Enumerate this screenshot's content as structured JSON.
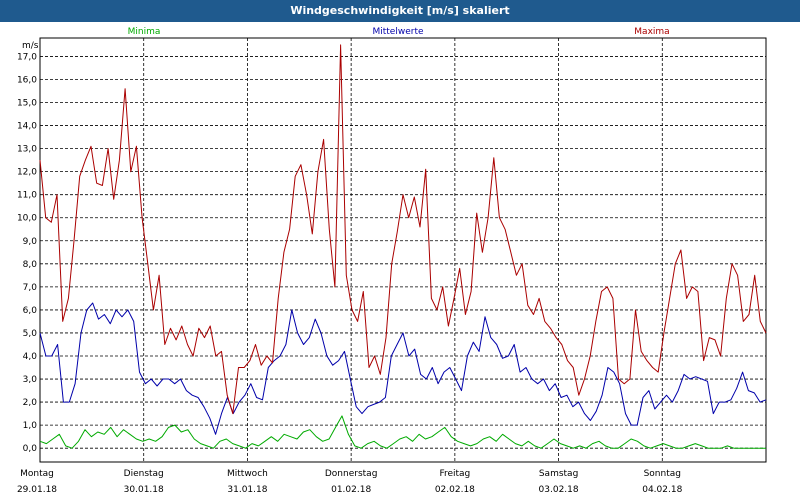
{
  "window": {
    "title": "Windgeschwindigkeit [m/s] skaliert"
  },
  "chart_data": {
    "type": "line",
    "title": "Windgeschwindigkeit [m/s] skaliert",
    "ylabel": "m/s",
    "ylim": [
      0,
      18
    ],
    "yticks": [
      "0,0",
      "1,0",
      "2,0",
      "3,0",
      "4,0",
      "5,0",
      "6,0",
      "7,0",
      "8,0",
      "9,0",
      "10,0",
      "11,0",
      "12,0",
      "13,0",
      "14,0",
      "15,0",
      "16,0",
      "17,0"
    ],
    "grid": true,
    "legend_position": "top",
    "x_days": [
      {
        "name": "Montag",
        "date": "29.01.18"
      },
      {
        "name": "Dienstag",
        "date": "30.01.18"
      },
      {
        "name": "Mittwoch",
        "date": "31.01.18"
      },
      {
        "name": "Donnerstag",
        "date": "01.02.18"
      },
      {
        "name": "Freitag",
        "date": "02.02.18"
      },
      {
        "name": "Samstag",
        "date": "03.02.18"
      },
      {
        "name": "Sonntag",
        "date": "04.02.18"
      }
    ],
    "series": [
      {
        "name": "Minima",
        "color": "#00aa00",
        "values": [
          0.3,
          0.2,
          0.4,
          0.6,
          0.1,
          0.0,
          0.3,
          0.8,
          0.5,
          0.7,
          0.6,
          0.9,
          0.5,
          0.8,
          0.6,
          0.4,
          0.3,
          0.4,
          0.3,
          0.5,
          0.9,
          1.0,
          0.7,
          0.8,
          0.4,
          0.2,
          0.1,
          0.0,
          0.3,
          0.4,
          0.2,
          0.1,
          0.0,
          0.2,
          0.1,
          0.3,
          0.5,
          0.3,
          0.6,
          0.5,
          0.4,
          0.7,
          0.8,
          0.5,
          0.3,
          0.4,
          0.9,
          1.4,
          0.6,
          0.1,
          0.0,
          0.2,
          0.3,
          0.1,
          0.0,
          0.2,
          0.4,
          0.5,
          0.3,
          0.6,
          0.4,
          0.5,
          0.7,
          0.9,
          0.5,
          0.3,
          0.2,
          0.1,
          0.2,
          0.4,
          0.5,
          0.3,
          0.6,
          0.4,
          0.2,
          0.1,
          0.3,
          0.1,
          0.0,
          0.2,
          0.4,
          0.2,
          0.1,
          0.0,
          0.1,
          0.0,
          0.2,
          0.3,
          0.1,
          0.0,
          0.0,
          0.2,
          0.4,
          0.3,
          0.1,
          0.0,
          0.1,
          0.2,
          0.1,
          0.0,
          0.0,
          0.1,
          0.2,
          0.1,
          0.0,
          0.0,
          0.0,
          0.1,
          0.0,
          0.0,
          0.0,
          0.0,
          0.0,
          0.0
        ]
      },
      {
        "name": "Mittelwerte",
        "color": "#0000aa",
        "values": [
          5.0,
          4.0,
          4.0,
          4.5,
          2.0,
          2.0,
          2.8,
          5.0,
          6.0,
          6.3,
          5.6,
          5.8,
          5.4,
          6.0,
          5.7,
          6.0,
          5.5,
          3.3,
          2.8,
          3.0,
          2.7,
          3.0,
          3.0,
          2.8,
          3.0,
          2.5,
          2.3,
          2.2,
          1.8,
          1.3,
          0.6,
          1.5,
          2.2,
          1.5,
          2.0,
          2.3,
          2.8,
          2.2,
          2.1,
          3.5,
          3.8,
          4.0,
          4.5,
          6.0,
          5.0,
          4.5,
          4.8,
          5.6,
          5.0,
          4.0,
          3.6,
          3.8,
          4.2,
          3.0,
          1.8,
          1.5,
          1.8,
          1.9,
          2.0,
          2.2,
          4.0,
          4.5,
          5.0,
          4.0,
          4.3,
          3.2,
          3.0,
          3.5,
          2.8,
          3.3,
          3.5,
          3.0,
          2.5,
          4.0,
          4.6,
          4.2,
          5.7,
          4.8,
          4.5,
          3.9,
          4.0,
          4.5,
          3.3,
          3.5,
          3.0,
          2.8,
          3.0,
          2.5,
          2.8,
          2.2,
          2.3,
          1.8,
          2.0,
          1.5,
          1.2,
          1.6,
          2.3,
          3.5,
          3.3,
          2.8,
          1.5,
          1.0,
          1.0,
          2.2,
          2.5,
          1.7,
          2.0,
          2.3,
          2.0,
          2.5,
          3.2,
          3.0,
          3.1,
          3.0,
          2.9,
          1.5,
          2.0,
          2.0,
          2.1,
          2.6,
          3.3,
          2.5,
          2.4,
          2.0,
          2.1
        ]
      },
      {
        "name": "Maxima",
        "color": "#aa0000",
        "values": [
          12.5,
          10.0,
          9.8,
          11.0,
          5.5,
          6.5,
          9.0,
          11.8,
          12.5,
          13.1,
          11.5,
          11.4,
          13.0,
          10.8,
          12.5,
          15.6,
          12.0,
          13.1,
          10.0,
          8.0,
          6.0,
          7.5,
          4.5,
          5.2,
          4.7,
          5.3,
          4.5,
          4.0,
          5.2,
          4.8,
          5.3,
          4.0,
          4.2,
          2.3,
          1.5,
          3.5,
          3.5,
          3.8,
          4.5,
          3.6,
          4.0,
          3.7,
          6.5,
          8.5,
          9.5,
          11.8,
          12.3,
          11.0,
          9.3,
          12.0,
          13.4,
          9.5,
          7.0,
          17.5,
          7.5,
          6.0,
          5.5,
          6.8,
          3.5,
          4.0,
          3.2,
          4.8,
          8.0,
          9.4,
          11.0,
          10.0,
          10.9,
          9.6,
          12.1,
          6.5,
          6.0,
          7.0,
          5.3,
          6.5,
          7.8,
          5.8,
          6.8,
          10.2,
          8.5,
          10.0,
          12.6,
          10.0,
          9.5,
          8.5,
          7.5,
          8.0,
          6.2,
          5.8,
          6.5,
          5.5,
          5.2,
          4.8,
          4.5,
          3.8,
          3.5,
          2.3,
          3.0,
          4.0,
          5.5,
          6.8,
          7.0,
          6.5,
          3.0,
          2.8,
          3.0,
          6.0,
          4.2,
          3.8,
          3.5,
          3.3,
          5.0,
          6.5,
          8.0,
          8.6,
          6.5,
          7.0,
          6.8,
          3.8,
          4.8,
          4.7,
          4.0,
          6.5,
          8.0,
          7.5,
          5.5,
          5.8,
          7.5,
          5.5,
          5.0
        ]
      }
    ]
  }
}
